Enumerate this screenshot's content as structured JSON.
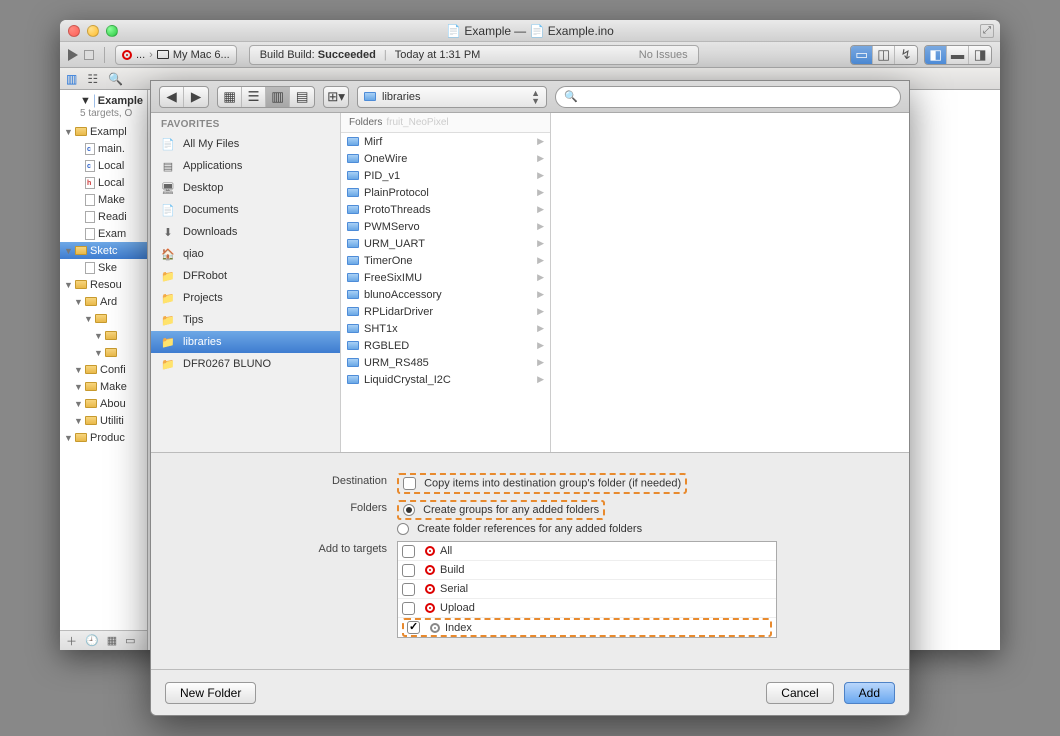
{
  "window": {
    "title_left": "Example",
    "title_sep": "—",
    "title_right": "Example.ino"
  },
  "toolbar": {
    "scheme_left": "...",
    "scheme_right": "My Mac 6...",
    "activity_prefix": "Build Build: ",
    "activity_status": "Succeeded",
    "activity_time": "Today at 1:31 PM",
    "activity_issues": "No Issues"
  },
  "project": {
    "root": "Example",
    "root_sub": "5 targets, O",
    "items": [
      {
        "label": "Exampl",
        "type": "group",
        "depth": 0
      },
      {
        "label": "main.",
        "type": "c",
        "depth": 1
      },
      {
        "label": "Local",
        "type": "c",
        "depth": 1
      },
      {
        "label": "Local",
        "type": "h",
        "depth": 1
      },
      {
        "label": "Make",
        "type": "file",
        "depth": 1
      },
      {
        "label": "Readi",
        "type": "file",
        "depth": 1
      },
      {
        "label": "Exam",
        "type": "file",
        "depth": 1
      },
      {
        "label": "Sketc",
        "type": "folder",
        "depth": 0,
        "sel": true
      },
      {
        "label": "Ske",
        "type": "file",
        "depth": 1
      },
      {
        "label": "Resou",
        "type": "group",
        "depth": 0
      },
      {
        "label": "Ard",
        "type": "folder",
        "depth": 1
      },
      {
        "label": "",
        "type": "folder",
        "depth": 2
      },
      {
        "label": "",
        "type": "folder",
        "depth": 3
      },
      {
        "label": "",
        "type": "folder",
        "depth": 3
      },
      {
        "label": "Confi",
        "type": "folder",
        "depth": 1
      },
      {
        "label": "Make",
        "type": "folder",
        "depth": 1
      },
      {
        "label": "Abou",
        "type": "folder",
        "depth": 1
      },
      {
        "label": "Utiliti",
        "type": "folder",
        "depth": 1
      },
      {
        "label": "Produc",
        "type": "group",
        "depth": 0
      }
    ]
  },
  "sheet": {
    "path": "libraries",
    "search_placeholder": "",
    "favorites_header": "FAVORITES",
    "favorites": [
      {
        "label": "All My Files",
        "icon": "📄"
      },
      {
        "label": "Applications",
        "icon": "▤"
      },
      {
        "label": "Desktop",
        "icon": "🖥"
      },
      {
        "label": "Documents",
        "icon": "📄"
      },
      {
        "label": "Downloads",
        "icon": "⬇"
      },
      {
        "label": "qiao",
        "icon": "🏠"
      },
      {
        "label": "DFRobot",
        "icon": "📁"
      },
      {
        "label": "Projects",
        "icon": "📁"
      },
      {
        "label": "Tips",
        "icon": "📁"
      },
      {
        "label": "libraries",
        "icon": "📁",
        "sel": true
      },
      {
        "label": "DFR0267 BLUNO",
        "icon": "📁"
      }
    ],
    "folders_header": "Folders",
    "ghost_item": "fruit_NeoPixel",
    "folders": [
      "Mirf",
      "OneWire",
      "PID_v1",
      "PlainProtocol",
      "ProtoThreads",
      "PWMServo",
      "URM_UART",
      "TimerOne",
      "FreeSixIMU",
      "blunoAccessory",
      "RPLidarDriver",
      "SHT1x",
      "RGBLED",
      "URM_RS485",
      "LiquidCrystal_I2C"
    ],
    "options": {
      "destination_label": "Destination",
      "destination_copy": "Copy items into destination group's folder (if needed)",
      "folders_label": "Folders",
      "folders_groups": "Create groups for any added folders",
      "folders_refs": "Create folder references for any added folders",
      "targets_label": "Add to targets",
      "targets": [
        {
          "name": "All",
          "checked": false,
          "gray": false
        },
        {
          "name": "Build",
          "checked": false,
          "gray": false
        },
        {
          "name": "Serial",
          "checked": false,
          "gray": false
        },
        {
          "name": "Upload",
          "checked": false,
          "gray": false
        },
        {
          "name": "Index",
          "checked": true,
          "gray": true
        }
      ]
    },
    "buttons": {
      "new_folder": "New Folder",
      "cancel": "Cancel",
      "add": "Add"
    }
  }
}
